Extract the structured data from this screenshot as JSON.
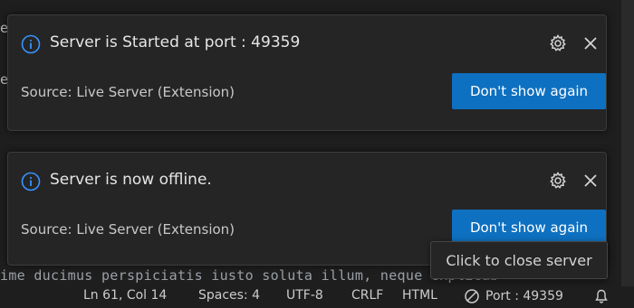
{
  "editor": {
    "code_line": "ime ducimus perspiciatis iusto soluta illum, neque explicab",
    "edge_glyph_1": "e",
    "edge_glyph_2": "e"
  },
  "notifications": [
    {
      "message": "Server is Started at port : 49359",
      "source": "Source: Live Server (Extension)",
      "button_label": "Don't show again"
    },
    {
      "message": "Server is now offline.",
      "source": "Source: Live Server (Extension)",
      "button_label": "Don't show again"
    }
  ],
  "tooltip": {
    "text": "Click to close server"
  },
  "statusbar": {
    "position": "Ln 61, Col 14",
    "spaces": "Spaces: 4",
    "encoding": "UTF-8",
    "eol": "CRLF",
    "language": "HTML",
    "port": "Port : 49359"
  },
  "colors": {
    "accent_button": "#0e70c0",
    "info_icon": "#3794ff",
    "toast_bg": "#252526"
  }
}
